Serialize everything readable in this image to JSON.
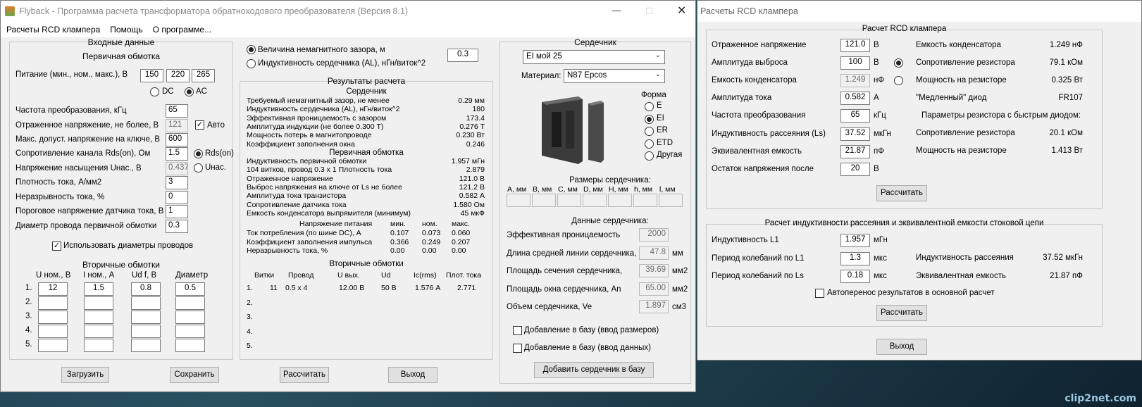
{
  "w1": {
    "title": "Flyback - Программа расчета трансформатора обратноходового преобразователя (Версия 8.1)",
    "menu": [
      "Расчеты RCD клампера",
      "Помощь",
      "О программе..."
    ],
    "input": {
      "title": "Входные данные",
      "primary": "Первичная обмотка",
      "supply_label": "Питание (мин., ном., макс.), В",
      "supply": [
        "150",
        "220",
        "265"
      ],
      "dc": "DC",
      "ac": "AC",
      "freq_label": "Частота преобразования, кГц",
      "freq": "65",
      "refl_label": "Отраженное напряжение, не более, В",
      "refl": "121",
      "auto": "Авто",
      "vmax_label": "Макс. допуст. напряжение на ключе, В",
      "vmax": "600",
      "rds_label": "Сопротивление канала Rds(on), Ом",
      "rds": "1.5",
      "rds_opt": "Rds(on)",
      "usat_label": "Напряжение насыщения Uнас., В",
      "usat": "0.437",
      "usat_opt": "Uнас.",
      "j_label": "Плотность тока, А/мм2",
      "j": "3",
      "cont_label": "Неразрывность тока, %",
      "cont": "0",
      "sense_label": "Пороговое напряжение датчика тока, В",
      "sense": "1",
      "wire_label": "Диаметр провода первичной обмотки",
      "wire": "0.3",
      "use_wire": "Использовать диаметры проводов",
      "secondary": "Вторичные обмотки",
      "sec_cols": [
        "U ном., В",
        "I ном., А",
        "Ud f, В",
        "Диаметр"
      ],
      "sec_rows": [
        {
          "n": "1.",
          "v": [
            "12",
            "1.5",
            "0.8",
            "0.5"
          ]
        },
        {
          "n": "2.",
          "v": [
            "",
            "",
            "",
            ""
          ]
        },
        {
          "n": "3.",
          "v": [
            "",
            "",
            "",
            ""
          ]
        },
        {
          "n": "4.",
          "v": [
            "",
            "",
            "",
            ""
          ]
        },
        {
          "n": "5.",
          "v": [
            "",
            "",
            "",
            ""
          ]
        }
      ],
      "load": "Загрузить",
      "save": "Сохранить"
    },
    "gap": {
      "opt1": "Величина немагнитного зазора, мм",
      "opt2": "Индуктивность сердечника (AL), нГн/виток^2",
      "value": "0.3"
    },
    "results": {
      "title": "Результаты расчета",
      "core": "Сердечник",
      "core_rows": [
        [
          "Требуемый немагнитный зазор, не менее",
          "0.29 мм"
        ],
        [
          "Индуктивность сердечника (AL), нГн/виток^2",
          "180"
        ],
        [
          "Эффективная проницаемость с зазором",
          "173.4"
        ],
        [
          "Амплитуда индукции        (не более 0.300 Т)",
          "0.276 Т"
        ],
        [
          "Мощность потерь в магнитопроводе",
          "0.230 Вт"
        ],
        [
          "Коэффициент заполнения окна",
          "0.246"
        ]
      ],
      "primary": "Первичная обмотка",
      "prim_rows": [
        [
          "Индуктивность первичной обмотки",
          "1.957 мГн"
        ],
        [
          "104 витков, провод 0.3 x 1           Плотность тока",
          "2.879"
        ],
        [
          "Отраженное напряжение",
          "121.0 В"
        ],
        [
          "Выброс напряжения на ключе от Ls не более",
          "121.2 В"
        ],
        [
          "Амплитуда тока транзистора",
          "0.582 А"
        ],
        [
          "Сопротивление датчика тока",
          "1.580 Ом"
        ],
        [
          "Емкость конденсатора выпрямителя (минимум)",
          "45 мкФ"
        ]
      ],
      "supply_hdr": [
        "Напряжение питания",
        "мин.",
        "ном.",
        "макс."
      ],
      "supply_rows": [
        {
          "l": "Ток потребления (по шине DC), А",
          "v": [
            "0.107",
            "0.073",
            "0.060"
          ]
        },
        {
          "l": "Коэффициент заполнения импульса",
          "v": [
            "0.366",
            "0.249",
            "0.207"
          ]
        },
        {
          "l": "Неразрывность тока, %",
          "v": [
            "0.00",
            "0.00",
            "0.00"
          ]
        }
      ],
      "secondary": "Вторичные обмотки",
      "sec_hdr": [
        "Витки",
        "Провод",
        "U вых.",
        "Ud",
        "Ic(rms)",
        "Плот. тока"
      ],
      "sec_rows": [
        {
          "n": "1.",
          "v": [
            "11",
            "0.5 x 4",
            "12.00 В",
            "50 В",
            "1.576 А",
            "2.771"
          ]
        },
        {
          "n": "2.",
          "v": [
            "",
            "",
            "",
            "",
            "",
            ""
          ]
        },
        {
          "n": "3.",
          "v": [
            "",
            "",
            "",
            "",
            "",
            ""
          ]
        },
        {
          "n": "4.",
          "v": [
            "",
            "",
            "",
            "",
            "",
            ""
          ]
        },
        {
          "n": "5.",
          "v": [
            "",
            "",
            "",
            "",
            "",
            ""
          ]
        }
      ],
      "calc": "Рассчитать",
      "exit": "Выход"
    },
    "core": {
      "title": "Сердечник",
      "core_sel": "EI мой 25",
      "mat_label": "Материал:",
      "mat_sel": "N87 Epcos",
      "form_label": "Форма",
      "forms": [
        "E",
        "EI",
        "ER",
        "ETD",
        "Другая"
      ],
      "dims_label": "Размеры сердечника:",
      "dims": [
        "A, мм",
        "B, мм",
        "C, мм",
        "D, мм",
        "H, мм",
        "h, мм",
        "l, мм"
      ],
      "data_label": "Данные сердечника:",
      "data_rows": [
        {
          "l": "Эффективная проницаемость",
          "v": "2000",
          "u": ""
        },
        {
          "l": "Длина средней линии сердечника,",
          "v": "47.8",
          "u": "мм"
        },
        {
          "l": "Площадь сечения сердечника,",
          "v": "39.69",
          "u": "мм2"
        },
        {
          "l": "Площадь окна сердечника, An",
          "v": "65.00",
          "u": "мм2"
        },
        {
          "l": "Объем сердечника, Ve",
          "v": "1.897",
          "u": "см3"
        }
      ],
      "add_dims": "Добавление в базу (ввод размеров)",
      "add_data": "Добавление в базу (ввод данных)",
      "add_btn": "Добавить сердечник в базу"
    }
  },
  "w2": {
    "title": "Расчеты RCD клампера",
    "g1": {
      "title": "Расчет RCD клампера",
      "rows": [
        {
          "l": "Отраженное напряжение",
          "v": "121.0",
          "u": "В"
        },
        {
          "l": "Амплитуда выброса",
          "v": "100",
          "u": "В"
        },
        {
          "l": "Емкость конденсатора",
          "v": "1.249",
          "u": "нФ"
        },
        {
          "l": "Амплитуда тока",
          "v": "0.582",
          "u": "А"
        },
        {
          "l": "Частота преобразования",
          "v": "65",
          "u": "кГц"
        },
        {
          "l": "Индуктивность рассеяния (Ls)",
          "v": "37.52",
          "u": "мкГн"
        },
        {
          "l": "Эквивалентная емкость",
          "v": "21.87",
          "u": "пФ"
        },
        {
          "l": "Остаток напряжения после",
          "v": "20",
          "u": "В"
        }
      ],
      "res": [
        {
          "l": "Емкость конденсатора",
          "v": "1.249 нФ"
        },
        {
          "l": "Сопротивление резистора",
          "v": "79.1 кОм"
        },
        {
          "l": "Мощность на резисторе",
          "v": "0.325 Вт"
        },
        {
          "l": "\"Медленный\" диод",
          "v": "FR107"
        }
      ],
      "fast_hdr": "Параметры резистора с быстрым диодом:",
      "fast": [
        {
          "l": "Сопротивление резистора",
          "v": "20.1 кОм"
        },
        {
          "l": "Мощность на резисторе",
          "v": "1.413 Вт"
        }
      ],
      "calc": "Рассчитать"
    },
    "g2": {
      "title": "Расчет индуктивности рассеяния и эквивалентной емкости стоковой цепи",
      "rows": [
        {
          "l": "Индуктивность L1",
          "v": "1.957",
          "u": "мГн"
        },
        {
          "l": "Период колебаний по L1",
          "v": "1.3",
          "u": "мкс"
        },
        {
          "l": "Период колебаний по Ls",
          "v": "0.18",
          "u": "мкс"
        }
      ],
      "res": [
        {
          "l": "Индуктивность рассеяния",
          "v": "37.52 мкГн"
        },
        {
          "l": "Эквивалентная емкость",
          "v": "21.87 пФ"
        }
      ],
      "auto": "Автоперенос результатов в основной расчет",
      "calc": "Рассчитать"
    },
    "exit": "Выход"
  },
  "watermark": "clip2net.com"
}
